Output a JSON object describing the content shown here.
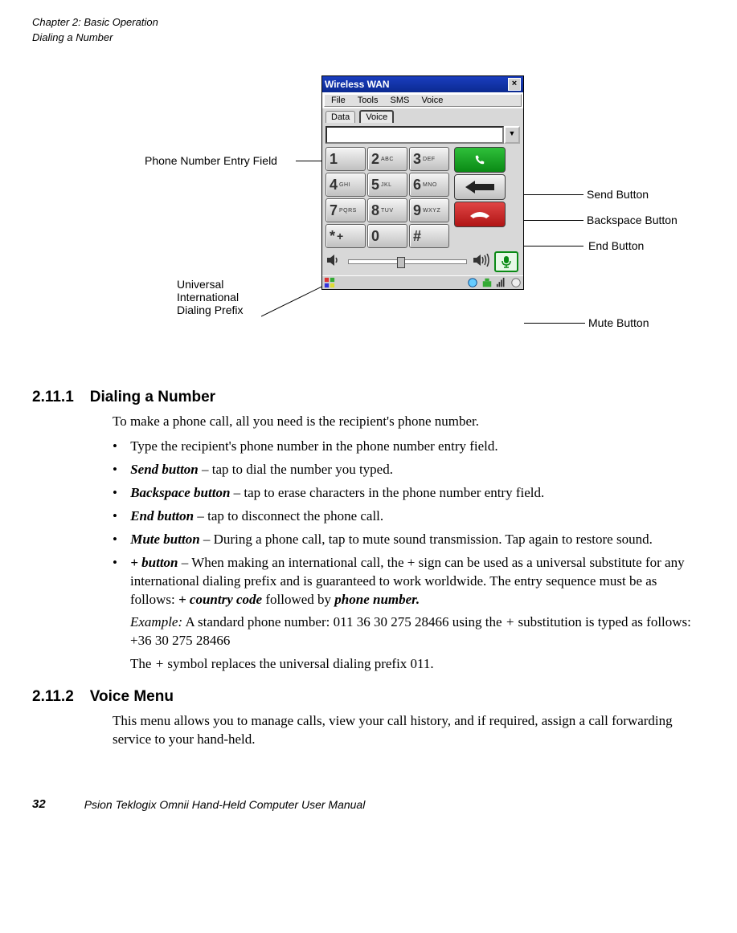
{
  "header": {
    "chapter": "Chapter 2: Basic Operation",
    "section": "Dialing a Number"
  },
  "window": {
    "title": "Wireless WAN",
    "menu": {
      "file": "File",
      "tools": "Tools",
      "sms": "SMS",
      "voice": "Voice"
    },
    "tabs": {
      "data": "Data",
      "voice": "Voice"
    },
    "keys": {
      "k1": "1",
      "k2": "2",
      "k2s": "ABC",
      "k3": "3",
      "k3s": "DEF",
      "k4": "4",
      "k4s": "GHI",
      "k5": "5",
      "k5s": "JKL",
      "k6": "6",
      "k6s": "MNO",
      "k7": "7",
      "k7s": "PQRS",
      "k8": "8",
      "k8s": "TUV",
      "k9": "9",
      "k9s": "WXYZ",
      "kstar": "*",
      "kplus": "+",
      "k0": "0",
      "khash": "#"
    }
  },
  "annotations": {
    "phone_entry": "Phone Number Entry Field",
    "send": "Send Button",
    "backspace": "Backspace Button",
    "end": "End Button",
    "intl_l1": "Universal",
    "intl_l2": "International",
    "intl_l3": "Dialing Prefix",
    "mute": "Mute Button"
  },
  "s1": {
    "num": "2.11.1",
    "title": "Dialing a Number",
    "intro": "To make a phone call, all you need is the recipient's phone number.",
    "b1": "Type the recipient's phone number in the phone number entry field.",
    "b2_label": "Send button",
    "b2_text": " – tap to dial the number you typed.",
    "b3_label": "Backspace button",
    "b3_text": " – tap to erase characters in the phone number entry field.",
    "b4_label": "End button",
    "b4_text": " – tap to disconnect the phone call.",
    "b5_label": "Mute button",
    "b5_text": " – During a phone call, tap to mute sound transmission. Tap again to restore sound.",
    "b6_label": " + button",
    "b6_text_a": " – When making an international call, the + sign can be used as a universal substitute for any international dialing prefix and is guaranteed to work worldwide. The entry sequence must be as follows: ",
    "b6_em1": "+ country code",
    "b6_mid": " followed by ",
    "b6_em2": "phone number.",
    "b6_ex_label": "Example:",
    "b6_ex_text": " A standard phone number: 011 36 30 275 28466 using the ",
    "b6_ex_plus": "+",
    "b6_ex_text2": " substitution is typed as follows: +36 30 275 28466",
    "b6_last_a": "The ",
    "b6_last_plus": "+",
    "b6_last_b": " symbol replaces the universal dialing prefix 011."
  },
  "s2": {
    "num": "2.11.2",
    "title": "Voice Menu",
    "intro": "This menu allows you to manage calls, view your call history, and if required, assign a call forwarding service to your hand-held."
  },
  "footer": {
    "page": "32",
    "book": "Psion Teklogix Omnii Hand-Held Computer User Manual"
  }
}
